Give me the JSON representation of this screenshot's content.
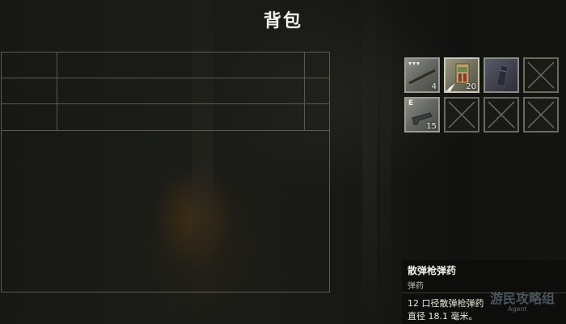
{
  "header": {
    "title": "背包"
  },
  "inventory": {
    "slots": [
      {
        "tag": "",
        "count": "4",
        "icon": "shotgun-icon"
      },
      {
        "tag": "",
        "count": "20",
        "icon": "shotgun-shells-box-icon"
      },
      {
        "tag": "",
        "count": "",
        "icon": "dark-item-icon"
      },
      {
        "tag": "",
        "count": "",
        "icon": "empty-slot-x-icon"
      },
      {
        "tag": "E",
        "count": "15",
        "icon": "pistol-icon"
      },
      {
        "tag": "",
        "count": "",
        "icon": "empty-slot-x-icon"
      },
      {
        "tag": "",
        "count": "",
        "icon": "empty-slot-x-icon"
      },
      {
        "tag": "",
        "count": "",
        "icon": "empty-slot-x-icon"
      }
    ]
  },
  "description": {
    "name": "散弹枪弹药",
    "type": "弹药",
    "line1": "12 口径散弹枪弹药",
    "line2": "直径 18.1 毫米。"
  },
  "watermark": {
    "text": "游民攻略组",
    "sub": "Agent"
  }
}
